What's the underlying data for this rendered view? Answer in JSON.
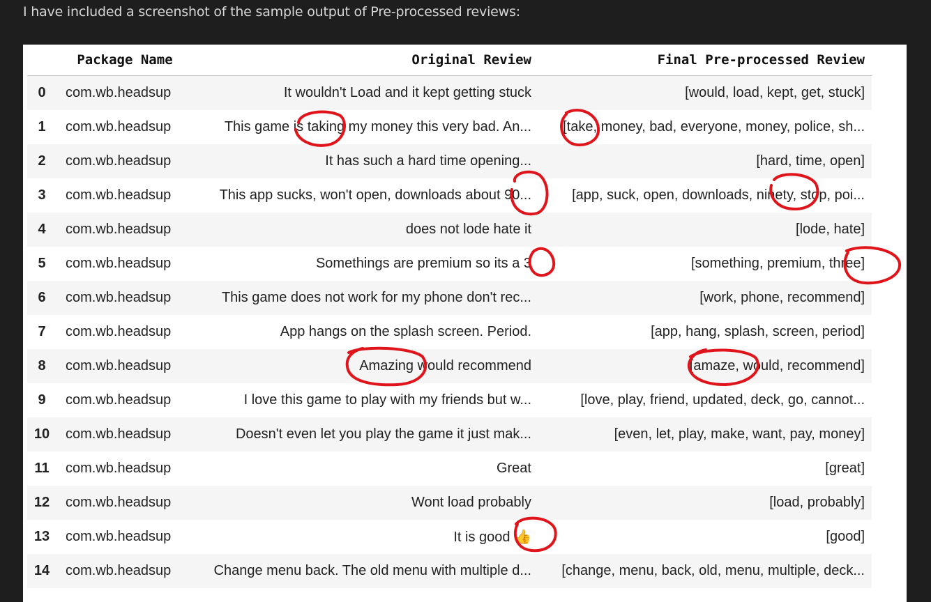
{
  "intro_text": "I have included a screenshot of the sample output of Pre-processed reviews:",
  "table": {
    "headers": [
      "",
      "Package Name",
      "Original Review",
      "Final Pre-processed Review"
    ],
    "rows": [
      {
        "idx": "0",
        "pkg": "com.wb.headsup",
        "orig": "It wouldn't Load and it kept getting stuck",
        "fin": "[would, load, kept, get, stuck]"
      },
      {
        "idx": "1",
        "pkg": "com.wb.headsup",
        "orig": "This game is taking my money this very bad. An...",
        "fin": "[take, money, bad, everyone, money, police, sh..."
      },
      {
        "idx": "2",
        "pkg": "com.wb.headsup",
        "orig": "It has such a hard time opening...",
        "fin": "[hard, time, open]"
      },
      {
        "idx": "3",
        "pkg": "com.wb.headsup",
        "orig": "This app sucks, won't open, downloads about 90...",
        "fin": "[app, suck, open, downloads, ninety, stop, poi..."
      },
      {
        "idx": "4",
        "pkg": "com.wb.headsup",
        "orig": "does not lode hate it",
        "fin": "[lode, hate]"
      },
      {
        "idx": "5",
        "pkg": "com.wb.headsup",
        "orig": "Somethings are premium so its a 3",
        "fin": "[something, premium, three]"
      },
      {
        "idx": "6",
        "pkg": "com.wb.headsup",
        "orig": "This game does not work for my phone don't rec...",
        "fin": "[work, phone, recommend]"
      },
      {
        "idx": "7",
        "pkg": "com.wb.headsup",
        "orig": "App hangs on the splash screen. Period.",
        "fin": "[app, hang, splash, screen, period]"
      },
      {
        "idx": "8",
        "pkg": "com.wb.headsup",
        "orig": "Amazing would recommend",
        "fin": "[amaze, would, recommend]"
      },
      {
        "idx": "9",
        "pkg": "com.wb.headsup",
        "orig": "I love this game to play with my friends but w...",
        "fin": "[love, play, friend, updated, deck, go, cannot..."
      },
      {
        "idx": "10",
        "pkg": "com.wb.headsup",
        "orig": "Doesn't even let you play the game it just mak...",
        "fin": "[even, let, play, make, want, pay, money]"
      },
      {
        "idx": "11",
        "pkg": "com.wb.headsup",
        "orig": "Great",
        "fin": "[great]"
      },
      {
        "idx": "12",
        "pkg": "com.wb.headsup",
        "orig": "Wont load probably",
        "fin": "[load, probably]"
      },
      {
        "idx": "13",
        "pkg": "com.wb.headsup",
        "orig": "It is good 👍",
        "fin": "[good]"
      },
      {
        "idx": "14",
        "pkg": "com.wb.headsup",
        "orig": "Change menu back. The old menu with multiple d...",
        "fin": "[change, menu, back, old, menu, multiple, deck..."
      }
    ]
  },
  "colors": {
    "page_bg": "#1e1e1e",
    "annotation": "#e0151b"
  }
}
